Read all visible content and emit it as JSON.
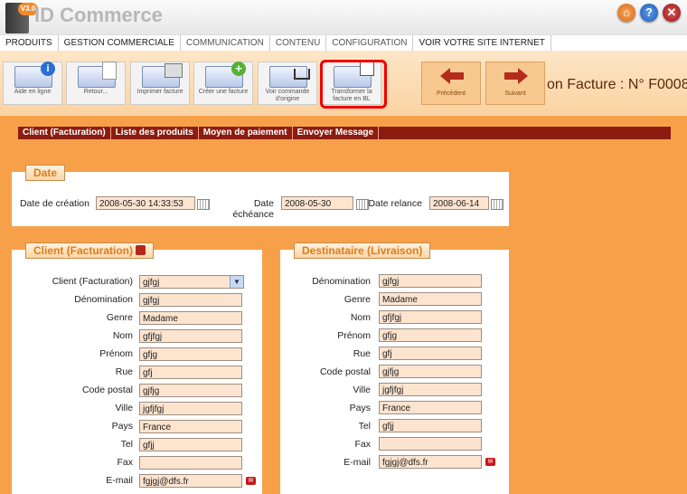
{
  "brand": {
    "badge": "V3.0",
    "name": "ID Commerce"
  },
  "menu": [
    "PRODUITS",
    "GESTION COMMERCIALE",
    "COMMUNICATION",
    "CONTENU",
    "CONFIGURATION",
    "VOIR VOTRE SITE INTERNET"
  ],
  "toolbar": {
    "help": "Aide en ligne",
    "back": "Retour...",
    "print": "Imprimer facture",
    "create": "Créer une facture",
    "order": "Voir commande d'origine",
    "transform": "Transformer la facture en BL",
    "prev": "Précédent",
    "next": "Suivant"
  },
  "page_title": "on Facture : N° F0008",
  "tabs": [
    "Client (Facturation)",
    "Liste des produits",
    "Moyen de paiement",
    "Envoyer Message"
  ],
  "date": {
    "legend": "Date",
    "creation_label": "Date de création",
    "creation_value": "2008-05-30 14:33:53",
    "due_label": "Date échéance",
    "due_value": "2008-05-30",
    "reminder_label": "Date relance",
    "reminder_value": "2008-06-14"
  },
  "client": {
    "legend": "Client (Facturation)",
    "fields": [
      {
        "label": "Client (Facturation)",
        "value": "gjfgj"
      },
      {
        "label": "Dénomination",
        "value": "gjfgj"
      },
      {
        "label": "Genre",
        "value": "Madame"
      },
      {
        "label": "Nom",
        "value": "gfjfgj"
      },
      {
        "label": "Prénom",
        "value": "gfjg"
      },
      {
        "label": "Rue",
        "value": "gfj"
      },
      {
        "label": "Code postal",
        "value": "gjfjg"
      },
      {
        "label": "Ville",
        "value": "jgfjfgj"
      },
      {
        "label": "Pays",
        "value": "France"
      },
      {
        "label": "Tel",
        "value": "gfjj"
      },
      {
        "label": "Fax",
        "value": ""
      },
      {
        "label": "E-mail",
        "value": "fgjgj@dfs.fr"
      }
    ]
  },
  "recipient": {
    "legend": "Destinataire (Livraison)",
    "fields": [
      {
        "label": "Dénomination",
        "value": "gjfgj"
      },
      {
        "label": "Genre",
        "value": "Madame"
      },
      {
        "label": "Nom",
        "value": "gfjfgj"
      },
      {
        "label": "Prénom",
        "value": "gfjg"
      },
      {
        "label": "Rue",
        "value": "gfj"
      },
      {
        "label": "Code postal",
        "value": "gjfjg"
      },
      {
        "label": "Ville",
        "value": "jgfjfgj"
      },
      {
        "label": "Pays",
        "value": "France"
      },
      {
        "label": "Tel",
        "value": "gfjj"
      },
      {
        "label": "Fax",
        "value": ""
      },
      {
        "label": "E-mail",
        "value": "fgjgj@dfs.fr"
      }
    ]
  }
}
